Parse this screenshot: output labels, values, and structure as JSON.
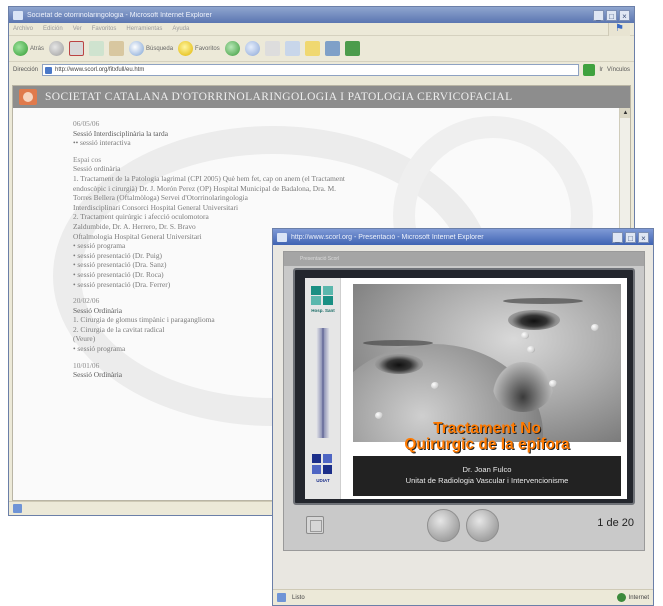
{
  "back_window": {
    "title": "Societat de otorrinolaringologia - Microsoft Internet Explorer",
    "controls": [
      "_",
      "□",
      "×"
    ],
    "menu": [
      "Archivo",
      "Edición",
      "Ver",
      "Favoritos",
      "Herramientas",
      "Ayuda"
    ],
    "toolbar": {
      "back_label": "Atrás",
      "search_label": "Búsqueda",
      "favorites_label": "Favoritos"
    },
    "address": {
      "label": "Dirección",
      "value": "http://www.scorl.org/fitxfull/eu.htm",
      "go_label": "Ir",
      "links_label": "Vínculos"
    },
    "site_title": "SOCIETAT CATALANA D'OTORRINOLARINGOLOGIA I PATOLOGIA CERVICOFACIAL",
    "lines": [
      {
        "text": "06/05/06",
        "style": "date"
      },
      {
        "text": "Sessió Interdisciplinària la tarda",
        "style": "strong"
      },
      {
        "text": "•• sessió interactiva",
        "style": ""
      },
      {
        "text": "Espai cos",
        "style": "date"
      },
      {
        "text": "Sessió ordinària",
        "style": ""
      },
      {
        "text": "1. Tractament de la Patologia lagrimal (CPI 2005) Què hem fet, cap on anem (el Tractament",
        "style": ""
      },
      {
        "text": "endoscòpic i cirurgià) Dr. J. Morón Perez (OP) Hospital Municipal de Badalona, Dra. M.",
        "style": ""
      },
      {
        "text": "Torres Bellera (Oftalmòloga) Servei d'Otorrinolaringologia",
        "style": ""
      },
      {
        "text": "Interdisciplinari Consorci Hospital General Universitari",
        "style": ""
      },
      {
        "text": "2. Tractament quirúrgic i afecció oculomotora",
        "style": ""
      },
      {
        "text": "Zaldumbide, Dr. A. Herrero, Dr. S. Bravo",
        "style": ""
      },
      {
        "text": "Oftalmologia Hospital General Universitari",
        "style": ""
      },
      {
        "text": "• sessió programa",
        "style": ""
      },
      {
        "text": "• sessió presentació (Dr. Puig)",
        "style": ""
      },
      {
        "text": "• sessió presentació (Dra. Sanz)",
        "style": ""
      },
      {
        "text": "• sessió presentació (Dr. Roca)",
        "style": ""
      },
      {
        "text": "• sessió presentació (Dra. Ferrer)",
        "style": ""
      },
      {
        "text": "20/02/06",
        "style": "date"
      },
      {
        "text": "Sessió Ordinària",
        "style": "strong"
      },
      {
        "text": "1. Cirurgia de glomus timpànic i paraganglioma",
        "style": ""
      },
      {
        "text": "2. Cirurgia de la cavitat radical",
        "style": ""
      },
      {
        "text": "(Veure)",
        "style": ""
      },
      {
        "text": "• sessió programa",
        "style": ""
      },
      {
        "text": "10/01/06",
        "style": "date"
      },
      {
        "text": "Sessió Ordinària",
        "style": "strong"
      }
    ]
  },
  "front_window": {
    "title": "http://www.scorl.org - Presentació - Microsoft Internet Explorer",
    "controls": [
      "_",
      "□",
      "×"
    ],
    "player_header": "Presentació Scorl",
    "slide": {
      "logo_top_label": "Hosp. Sant",
      "logo_bottom_label": "UDIAT",
      "title_line1": "Tractament No",
      "title_line2": "Quirurgic de la epifora",
      "author": "Dr. Joan Fulco",
      "unit": "Unitat de Radiologia Vascular i Intervencionisme"
    },
    "counter": "1 de 20",
    "status": {
      "left": "Listo",
      "zone": "Internet"
    }
  }
}
